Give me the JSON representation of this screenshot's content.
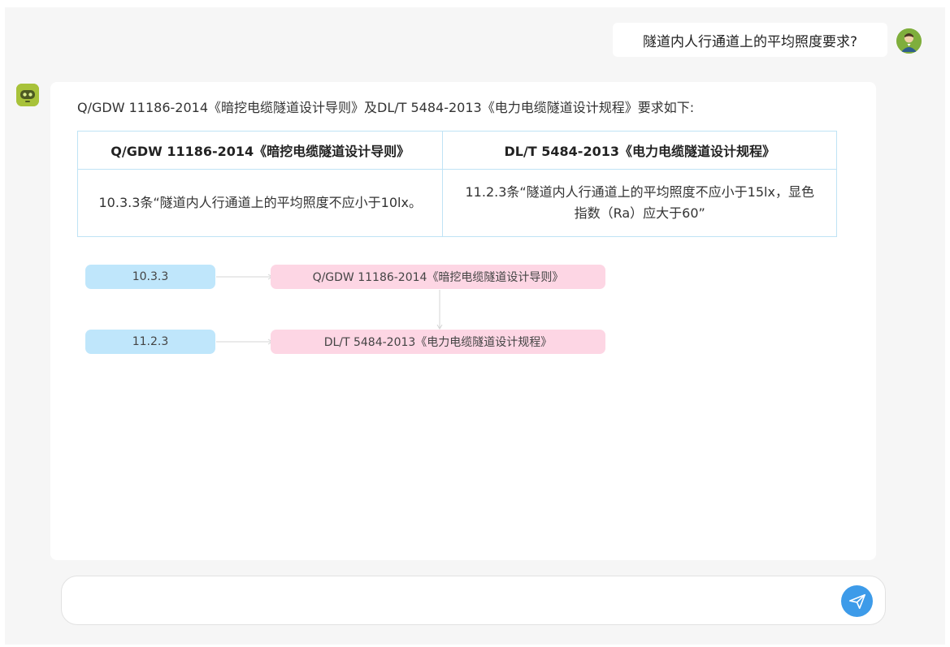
{
  "user": {
    "question": "隧道内人行通道上的平均照度要求?"
  },
  "answer": {
    "intro": "Q/GDW 11186-2014《暗挖电缆隧道设计导则》及DL/T 5484-2013《电力电缆隧道设计规程》要求如下:",
    "table": {
      "headers": [
        "Q/GDW 11186-2014《暗挖电缆隧道设计导则》",
        "DL/T 5484-2013《电力电缆隧道设计规程》"
      ],
      "row": {
        "left": "10.3.3条“隧道内人行通道上的平均照度不应小于10lx。",
        "right_line1": "11.2.3条“隧道内人行通道上的平均照度不应小于15lx，显色",
        "right_line2": "指数（Ra）应大于60”"
      }
    },
    "flow": {
      "clause_a": "10.3.3",
      "clause_b": "11.2.3",
      "standard_a": "Q/GDW 11186-2014《暗挖电缆隧道设计导则》",
      "standard_b": "DL/T 5484-2013《电力电缆隧道设计规程》"
    }
  },
  "input": {
    "value": "",
    "placeholder": ""
  },
  "icons": {
    "user_avatar": "user-avatar-icon",
    "bot_avatar": "robot-icon",
    "send": "paper-plane-icon"
  },
  "colors": {
    "accent": "#3d9be9",
    "table_border": "#bfe3f5",
    "node_blue": "#bfe6fb",
    "node_pink": "#fdd6e4",
    "bot_avatar": "#a8c23a"
  }
}
